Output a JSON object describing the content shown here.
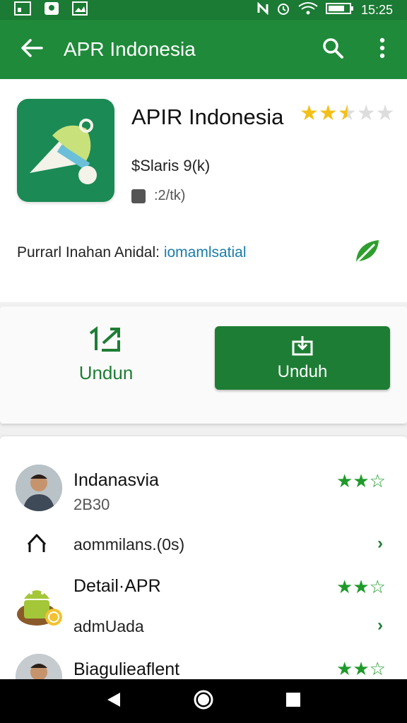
{
  "status_bar": {
    "time": "15:25",
    "icons": [
      "gallery-icon",
      "shield-icon",
      "image-icon",
      "nfc-icon",
      "alarm-icon",
      "wifi-icon",
      "battery-icon"
    ]
  },
  "app_bar": {
    "title": "APR  Indonesia",
    "back_icon": "arrow-left-icon",
    "search_icon": "search-icon",
    "menu_icon": "more-vert-icon"
  },
  "app_info": {
    "name": "APIR Indonesia",
    "rating_stars": 2.5,
    "rating_max": 5,
    "price_text": "$Slaris  9(k)",
    "meta_text": ":2/tk)",
    "provider_label": "Purrarl Inahan Anidal:",
    "provider_link": "iomamlsatial"
  },
  "actions": {
    "secondary_label": "Undun",
    "primary_label": "Unduh"
  },
  "list": {
    "items": [
      {
        "title": "Indanasvia",
        "subtitle": "2B30",
        "stars": 2.5
      },
      {
        "text": "aommilans.(0s)"
      },
      {
        "title": "Detail·APR",
        "stars": 2.5
      },
      {
        "text": "admUada"
      },
      {
        "title": "Biagulieaflent",
        "stars": 2.5
      }
    ]
  },
  "colors": {
    "status_bar": "#1b7a34",
    "app_bar": "#1f8a3a",
    "primary_button": "#1e7d34",
    "star_gold": "#f3c019",
    "star_green": "#1f9a2a",
    "link": "#1a7ca8"
  }
}
